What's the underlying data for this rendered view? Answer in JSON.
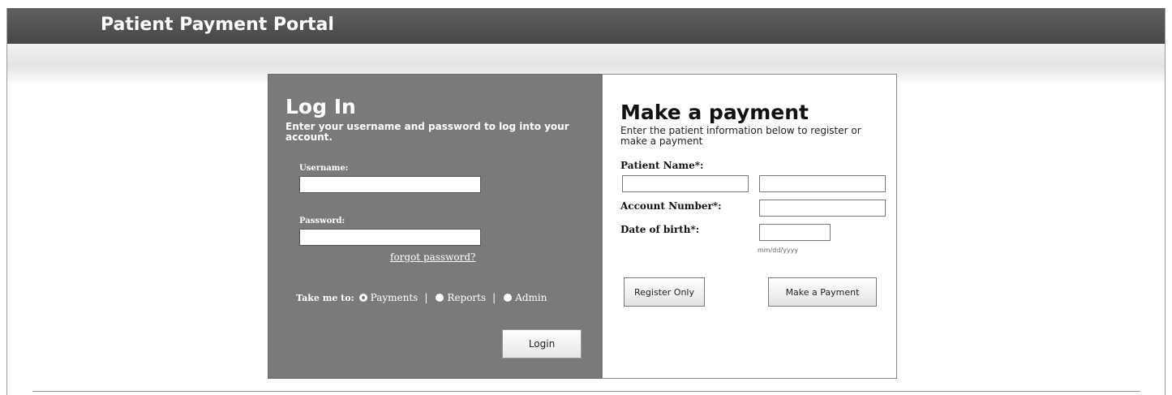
{
  "header": {
    "title": "Patient Payment Portal"
  },
  "login": {
    "title": "Log In",
    "description": "Enter your username and password to log into your account.",
    "username_label": "Username:",
    "username_value": "",
    "password_label": "Password:",
    "password_value": "",
    "forgot_link": "forgot password?",
    "take_me_label": "Take me to:",
    "options": [
      {
        "label": "Payments",
        "selected": true
      },
      {
        "label": "Reports",
        "selected": false
      },
      {
        "label": "Admin",
        "selected": false
      }
    ],
    "separator": "|",
    "login_button": "Login"
  },
  "payment": {
    "title": "Make a payment",
    "description": "Enter the patient information below to register or make a payment",
    "patient_name_label": "Patient Name*:",
    "first_name_value": "",
    "last_name_value": "",
    "account_number_label": "Account Number*:",
    "account_number_value": "",
    "dob_label": "Date of birth*:",
    "dob_value": "",
    "dob_hint": "mm/dd/yyyy",
    "register_button": "Register Only",
    "make_payment_button": "Make a Payment"
  },
  "colors": {
    "header_bg": "#4f4f4f",
    "login_panel_bg": "#7a7a7a"
  }
}
